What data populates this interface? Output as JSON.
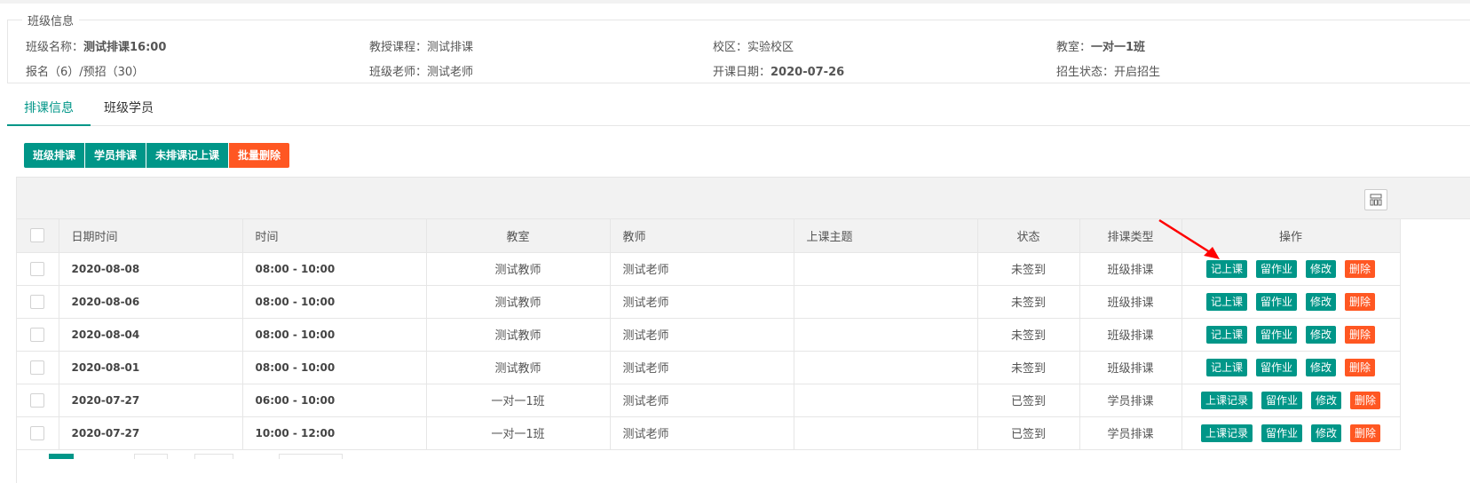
{
  "class_info": {
    "legend": "班级信息",
    "name_label": "班级名称：",
    "name_value": "测试排课16:00",
    "course_label": "教授课程：",
    "course_value": "测试排课",
    "campus_label": "校区：",
    "campus_value": "实验校区",
    "classroom_label": "教室：",
    "classroom_value": "一对一1班",
    "enroll_text": "报名（6）/预招（30）",
    "teacher_label": "班级老师：",
    "teacher_value": "测试老师",
    "start_label": "开课日期：",
    "start_value": "2020-07-26",
    "status_label": "招生状态：",
    "status_value": "开启招生"
  },
  "tabs": [
    {
      "label": "排课信息",
      "active": true
    },
    {
      "label": "班级学员",
      "active": false
    }
  ],
  "actions": {
    "class_schedule": "班级排课",
    "student_schedule": "学员排课",
    "unscheduled_record": "未排课记上课",
    "batch_delete": "批量删除"
  },
  "table": {
    "headers": {
      "datetime": "日期时间",
      "time": "时间",
      "classroom": "教室",
      "teacher": "教师",
      "topic": "上课主题",
      "status": "状态",
      "type": "排课类型",
      "ops": "操作"
    },
    "rows": [
      {
        "date": "2020-08-08",
        "time": "08:00 - 10:00",
        "classroom": "测试教师",
        "teacher": "测试老师",
        "topic": "",
        "status": "未签到",
        "type": "班级排课",
        "ops": [
          "记上课",
          "留作业",
          "修改",
          "删除"
        ]
      },
      {
        "date": "2020-08-06",
        "time": "08:00 - 10:00",
        "classroom": "测试教师",
        "teacher": "测试老师",
        "topic": "",
        "status": "未签到",
        "type": "班级排课",
        "ops": [
          "记上课",
          "留作业",
          "修改",
          "删除"
        ]
      },
      {
        "date": "2020-08-04",
        "time": "08:00 - 10:00",
        "classroom": "测试教师",
        "teacher": "测试老师",
        "topic": "",
        "status": "未签到",
        "type": "班级排课",
        "ops": [
          "记上课",
          "留作业",
          "修改",
          "删除"
        ]
      },
      {
        "date": "2020-08-01",
        "time": "08:00 - 10:00",
        "classroom": "测试教师",
        "teacher": "测试老师",
        "topic": "",
        "status": "未签到",
        "type": "班级排课",
        "ops": [
          "记上课",
          "留作业",
          "修改",
          "删除"
        ]
      },
      {
        "date": "2020-07-27",
        "time": "06:00 - 10:00",
        "classroom": "一对一1班",
        "teacher": "测试老师",
        "topic": "",
        "status": "已签到",
        "type": "学员排课",
        "ops": [
          "上课记录",
          "留作业",
          "修改",
          "删除"
        ]
      },
      {
        "date": "2020-07-27",
        "time": "10:00 - 12:00",
        "classroom": "一对一1班",
        "teacher": "测试老师",
        "topic": "",
        "status": "已签到",
        "type": "学员排课",
        "ops": [
          "上课记录",
          "留作业",
          "修改",
          "删除"
        ]
      }
    ]
  },
  "colors": {
    "primary": "#009688",
    "danger": "#ff5722",
    "arrow": "#ff0000"
  }
}
